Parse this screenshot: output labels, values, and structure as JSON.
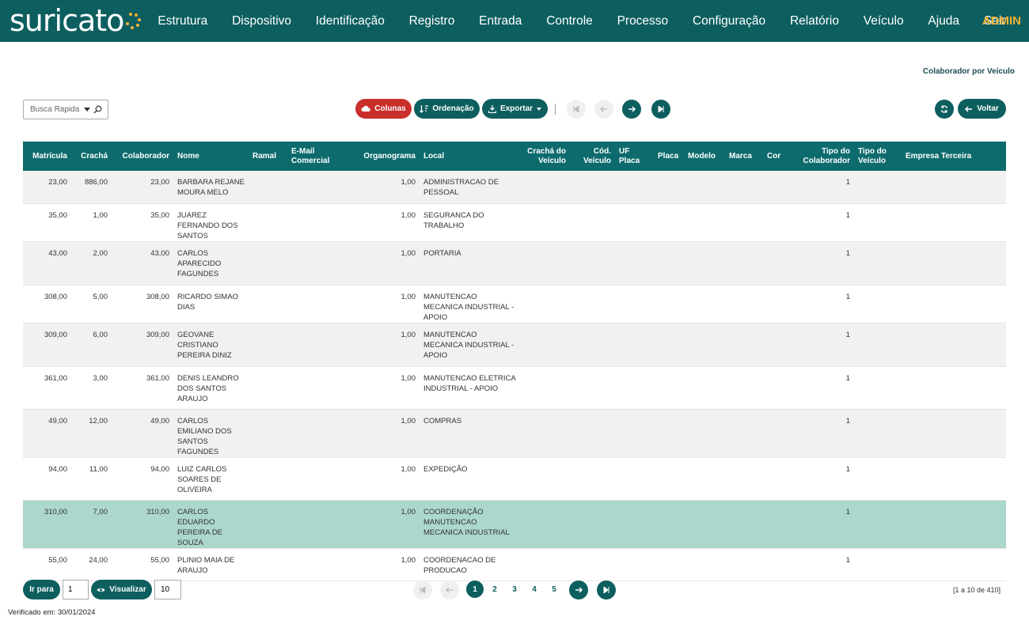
{
  "app": {
    "logo_text": "suricato",
    "user": "ADMIN",
    "brand_color": "#0d5e5f",
    "accent_color": "#f3b234"
  },
  "nav": [
    "Estrutura",
    "Dispositivo",
    "Identificação",
    "Registro",
    "Entrada",
    "Controle",
    "Processo",
    "Configuração",
    "Relatório",
    "Veículo",
    "Ajuda",
    "Sair"
  ],
  "page_title": "Colaborador por Veículo",
  "toolbar": {
    "search_placeholder": "Busca Rapida",
    "columns_label": "Colunas",
    "sort_label": "Ordenação",
    "export_label": "Exportar",
    "back_label": "Voltar"
  },
  "table": {
    "headers": [
      "Matrícula",
      "Crachá",
      "Colaborador",
      "Nome",
      "Ramal",
      "E-Mail Comercial",
      "Organograma",
      "Local",
      "Crachá do Veículo",
      "Cód. Veículo",
      "UF Placa",
      "Placa",
      "Modelo",
      "Marca",
      "Cor",
      "Tipo do Colaborador",
      "Tipo do Veículo",
      "Empresa Terceira"
    ],
    "rows": [
      [
        "23,00",
        "886,00",
        "23,00",
        "BARBARA REJANE MOURA MELO",
        "",
        "",
        "1,00",
        "ADMINISTRACAO DE PESSOAL",
        "",
        "",
        "",
        "",
        "",
        "",
        "",
        "1",
        "",
        ""
      ],
      [
        "35,00",
        "1,00",
        "35,00",
        "JUAREZ FERNANDO DOS SANTOS",
        "",
        "",
        "1,00",
        "SEGURANCA DO TRABALHO",
        "",
        "",
        "",
        "",
        "",
        "",
        "",
        "1",
        "",
        ""
      ],
      [
        "43,00",
        "2,00",
        "43,00",
        "CARLOS APARECIDO FAGUNDES",
        "",
        "",
        "1,00",
        "PORTARIA",
        "",
        "",
        "",
        "",
        "",
        "",
        "",
        "1",
        "",
        ""
      ],
      [
        "308,00",
        "5,00",
        "308,00",
        "RICARDO SIMAO DIAS",
        "",
        "",
        "1,00",
        "MANUTENCAO MECANICA INDUSTRIAL - APOIO",
        "",
        "",
        "",
        "",
        "",
        "",
        "",
        "1",
        "",
        ""
      ],
      [
        "309,00",
        "6,00",
        "309,00",
        "GEOVANE CRISTIANO PEREIRA DINIZ",
        "",
        "",
        "1,00",
        "MANUTENCAO MECANICA INDUSTRIAL - APOIO",
        "",
        "",
        "",
        "",
        "",
        "",
        "",
        "1",
        "",
        ""
      ],
      [
        "361,00",
        "3,00",
        "361,00",
        "DENIS LEANDRO DOS SANTOS ARAUJO",
        "",
        "",
        "1,00",
        "MANUTENCAO ELETRICA INDUSTRIAL - APOIO",
        "",
        "",
        "",
        "",
        "",
        "",
        "",
        "1",
        "",
        ""
      ],
      [
        "49,00",
        "12,00",
        "49,00",
        "CARLOS EMILIANO DOS SANTOS FAGUNDES",
        "",
        "",
        "1,00",
        "COMPRAS",
        "",
        "",
        "",
        "",
        "",
        "",
        "",
        "1",
        "",
        ""
      ],
      [
        "94,00",
        "11,00",
        "94,00",
        "LUIZ CARLOS SOARES DE OLIVEIRA",
        "",
        "",
        "1,00",
        "EXPEDIÇÃO",
        "",
        "",
        "",
        "",
        "",
        "",
        "",
        "1",
        "",
        ""
      ],
      [
        "310,00",
        "7,00",
        "310,00",
        "CARLOS EDUARDO PEREIRA DE SOUZA",
        "",
        "",
        "1,00",
        "COORDENAÇÃO MANUTENCAO MECANICA INDUSTRIAL",
        "",
        "",
        "",
        "",
        "",
        "",
        "",
        "1",
        "",
        ""
      ],
      [
        "55,00",
        "24,00",
        "55,00",
        "PLINIO MAIA DE ARAUJO",
        "",
        "",
        "1,00",
        "COORDENACAO DE PRODUCAO",
        "",
        "",
        "",
        "",
        "",
        "",
        "",
        "1",
        "",
        ""
      ]
    ],
    "selected_row": 8
  },
  "footer": {
    "goto_label": "Ir para",
    "goto_value": "1",
    "view_label": "Visualizar",
    "view_value": "10",
    "pages": [
      "1",
      "2",
      "3",
      "4",
      "5"
    ],
    "current_page": "1",
    "range_text": "[1 a 10 de 410]",
    "verified_text": "Verificado em: 30/01/2024"
  }
}
